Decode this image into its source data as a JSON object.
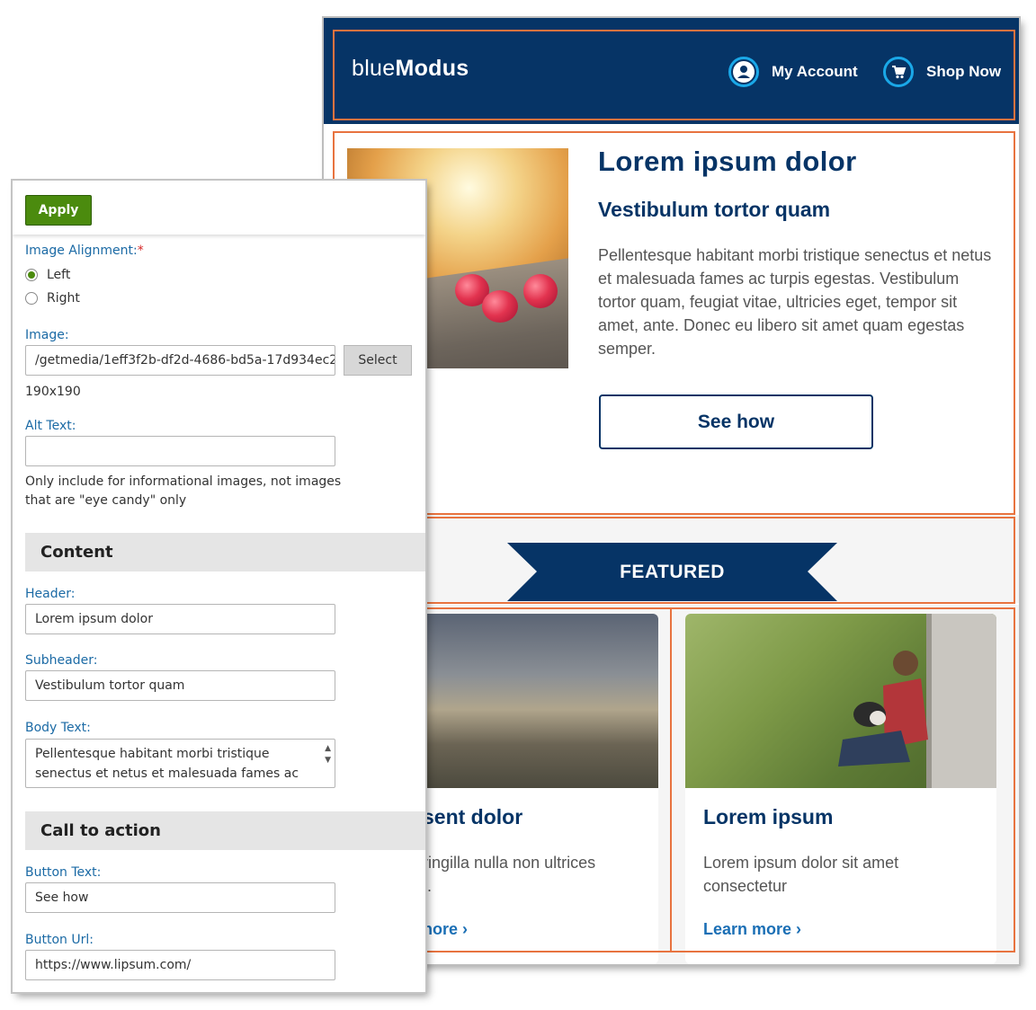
{
  "preview": {
    "brand_light": "blue",
    "brand_bold": "Modus",
    "nav": {
      "account_label": "My Account",
      "shop_label": "Shop Now"
    },
    "hero": {
      "title": "Lorem ipsum dolor",
      "subtitle": "Vestibulum tortor quam",
      "body": "Pellentesque habitant morbi tristique senectus et netus et malesuada fames ac turpis egestas. Vestibulum tortor quam, feugiat vitae, ultricies eget, tempor sit amet, ante. Donec eu libero sit amet quam egestas semper.",
      "cta": "See how"
    },
    "featured_label": "FEATURED",
    "cards": [
      {
        "title": "sent dolor",
        "text_line1": "ringilla nulla non ultrices",
        "text_line2": "t.",
        "link": "nore ›"
      },
      {
        "title": "Lorem ipsum",
        "text_line1": "Lorem ipsum dolor sit amet",
        "text_line2": "consectetur",
        "link": "Learn more ›"
      }
    ],
    "colors": {
      "navy": "#063466",
      "accent_blue": "#1aa8e8",
      "selection_orange": "#e8733f",
      "link_blue": "#1b6fb5"
    }
  },
  "panel": {
    "apply_label": "Apply",
    "image_alignment": {
      "label": "Image Alignment:",
      "required_mark": "*",
      "options": [
        "Left",
        "Right"
      ],
      "selected": "Left"
    },
    "image": {
      "label": "Image:",
      "value": "/getmedia/1eff3f2b-df2d-4686-bd5a-17d934ec2",
      "select_label": "Select",
      "size_note": "190x190"
    },
    "alt_text": {
      "label": "Alt Text:",
      "value": "",
      "help_line1": "Only include for informational images, not images",
      "help_line2": "that are \"eye candy\" only"
    },
    "content_section": "Content",
    "header": {
      "label": "Header:",
      "value": "Lorem ipsum dolor"
    },
    "subheader": {
      "label": "Subheader:",
      "value": "Vestibulum tortor quam"
    },
    "body_text": {
      "label": "Body Text:",
      "line1": "Pellentesque habitant morbi tristique",
      "line2": "senectus et netus et malesuada fames ac"
    },
    "cta_section": "Call to action",
    "button_text": {
      "label": "Button Text:",
      "value": "See how"
    },
    "button_url": {
      "label": "Button Url:",
      "value": "https://www.lipsum.com/"
    },
    "colors": {
      "apply_green": "#4b8b0e",
      "label_blue": "#1b6aa5",
      "required_red": "#d62828"
    }
  }
}
